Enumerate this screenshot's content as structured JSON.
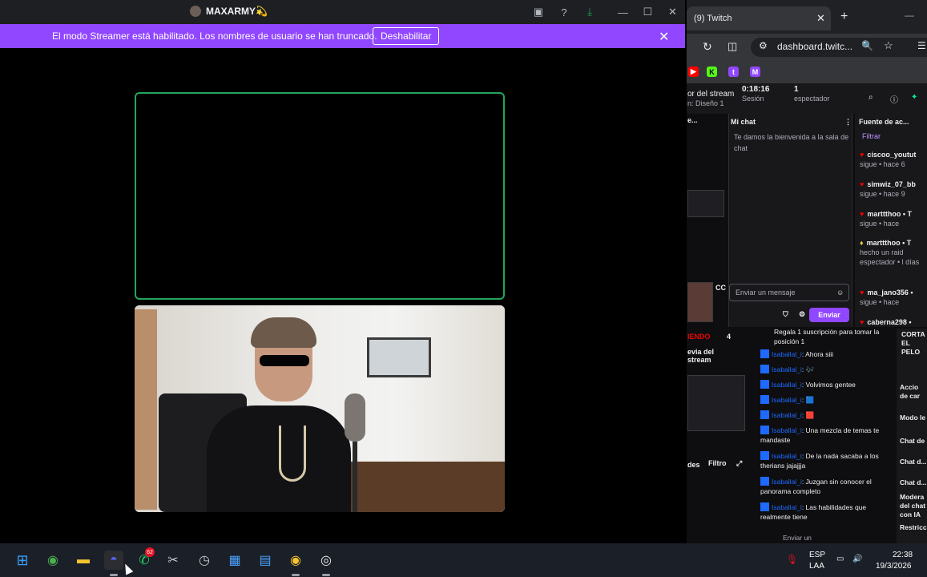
{
  "discord": {
    "window_title": "MAXARMY💫",
    "toolbar_icons": [
      "screen-share-icon",
      "help-icon",
      "download-icon"
    ],
    "window_controls": [
      "—",
      "☐",
      "✕"
    ],
    "streamer_banner": {
      "text": "El modo Streamer está habilitado. Los nombres de usuario se han truncado.",
      "button_label": "Deshabilitar",
      "close": "✕"
    }
  },
  "browser": {
    "tab_title": "(9) Twitch",
    "tab_close": "✕",
    "new_tab": "+",
    "minimize": "—",
    "url": "dashboard.twitc...",
    "bookmark_icons": [
      "youtube-icon",
      "kick-icon",
      "twitch-icon",
      "gmail-icon"
    ]
  },
  "twitch": {
    "stats": {
      "stream_label": "or del stream",
      "layout_label": "n: Diseño 1",
      "session_time": "0:18:16",
      "session_label": "Sesión",
      "viewers_count": "1",
      "viewers_label": "espectador"
    },
    "panels": {
      "left_header": "e...",
      "chat_header": "Mi chat",
      "activity_header": "Fuente de ac..."
    },
    "chat": {
      "welcome": "Te damos la bienvenida a la sala de chat",
      "input_placeholder": "Enviar un mensaje",
      "send_label": "Enviar"
    },
    "activity": {
      "filter_label": "Filtrar",
      "items": [
        {
          "name": "ciscoo_youtut",
          "detail": "sigue • hace 6"
        },
        {
          "name": "simwiz_07_bb",
          "detail": "sigue • hace 9"
        },
        {
          "name": "marttthoo • T",
          "detail": "sigue • hace"
        },
        {
          "name": "marttthoo • T",
          "detail": "hecho un raid espectador • l días"
        },
        {
          "name": "ma_jano356 •",
          "detail": "sigue • hace"
        },
        {
          "name": "caberna298 •",
          "detail": ""
        }
      ]
    },
    "left_labels": {
      "cc": "CC",
      "trending": "IENDO",
      "trending_count": "4",
      "preview": "evia del stream",
      "des": "des",
      "filtro": "Filtro"
    },
    "gift_prompt": "Regala 1 suscripción para tomar la posición 1",
    "chat_messages": [
      {
        "user": "Isaballal_i",
        "text": ": Ahora siii"
      },
      {
        "user": "Isaballal_i",
        "text": ": 🎶"
      },
      {
        "user": "Isaballal_i",
        "text": ": Volvimos gentee"
      },
      {
        "user": "Isaballal_i",
        "text": ": 🟦"
      },
      {
        "user": "Isaballal_i",
        "text": ": 🟥"
      },
      {
        "user": "Isaballal_i",
        "text": ": Una mezcla de temas te mandaste"
      },
      {
        "user": "Isaballal_i",
        "text": ": De la nada sacaba a los therians jajajjja"
      },
      {
        "user": "Isaballal_i",
        "text": ": Juzgan sin conocer el panorama completo"
      },
      {
        "user": "Isaballal_i",
        "text": ": Las habilidades que realmente tiene"
      }
    ],
    "lower_input": "Enviar un",
    "right_items": [
      "CORTA EL PELO",
      "Accio de car",
      "Modo le",
      "Chat de",
      "Chat d...",
      "Chat d...",
      "Modera del chat con IA",
      "Restricc"
    ]
  },
  "taskbar": {
    "apps": [
      "windows-start-icon",
      "chrome-icon",
      "file-explorer-icon",
      "discord-icon",
      "whatsapp-icon",
      "snipping-tool-icon",
      "clock-icon",
      "calculator-icon",
      "notepad-icon",
      "chrome-profile-icon",
      "obs-icon"
    ],
    "whatsapp_badge": "62",
    "lang_line1": "ESP",
    "lang_line2": "LAA",
    "time": "22:38",
    "date": "19/3/2026"
  },
  "colors": {
    "streamer_purple": "#9147ff",
    "speaking_green": "#23a55a",
    "twitch_bg": "#0e0e10"
  }
}
